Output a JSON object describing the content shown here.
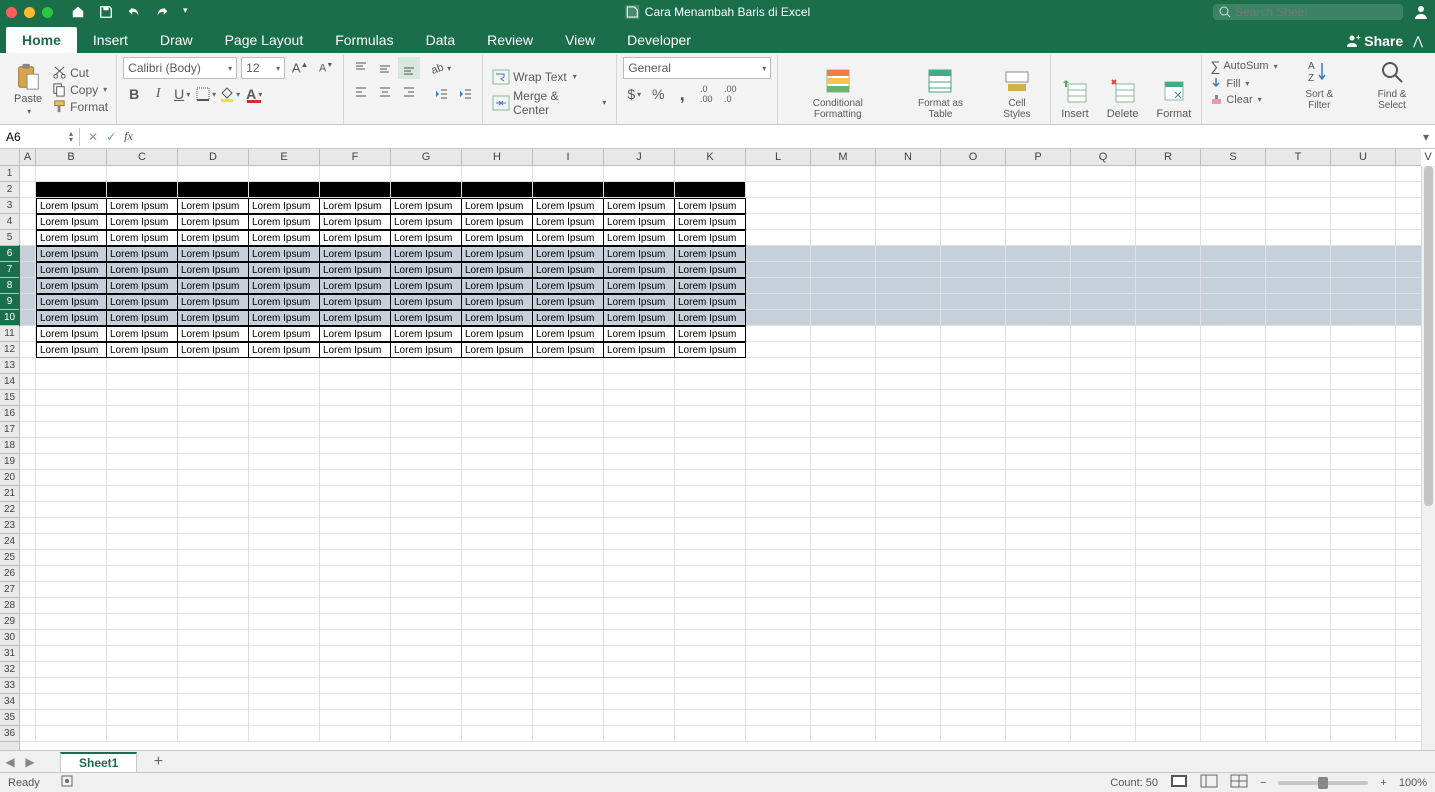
{
  "window": {
    "title": "Cara Menambah Baris di Excel"
  },
  "search": {
    "placeholder": "Search Sheet"
  },
  "tabs": [
    "Home",
    "Insert",
    "Draw",
    "Page Layout",
    "Formulas",
    "Data",
    "Review",
    "View",
    "Developer"
  ],
  "activeTab": "Home",
  "share": "Share",
  "clipboard": {
    "paste": "Paste",
    "cut": "Cut",
    "copy": "Copy",
    "format": "Format"
  },
  "font": {
    "name": "Calibri (Body)",
    "size": "12"
  },
  "wrap": "Wrap Text",
  "merge": "Merge & Center",
  "numberFormat": "General",
  "styles": {
    "cond": "Conditional Formatting",
    "table": "Format as Table",
    "cell": "Cell Styles"
  },
  "cells": {
    "insert": "Insert",
    "delete": "Delete",
    "format": "Format"
  },
  "editing": {
    "autosum": "AutoSum",
    "fill": "Fill",
    "clear": "Clear",
    "sort": "Sort & Filter",
    "find": "Find & Select"
  },
  "namebox": "A6",
  "columns": [
    "A",
    "B",
    "C",
    "D",
    "E",
    "F",
    "G",
    "H",
    "I",
    "J",
    "K",
    "L",
    "M",
    "N",
    "O",
    "P",
    "Q",
    "R",
    "S",
    "T",
    "U",
    "V"
  ],
  "colWidths": {
    "A": 16,
    "data": 71,
    "rest": 65
  },
  "rows": 36,
  "dataText": "Lorem Ipsum",
  "dataCols": 10,
  "dataRows": {
    "blackHeader": 2,
    "first": 3,
    "last": 12
  },
  "selectedRows": {
    "first": 6,
    "last": 10
  },
  "sheetTab": "Sheet1",
  "status": {
    "ready": "Ready",
    "count": "Count: 50",
    "zoom": "100%"
  }
}
